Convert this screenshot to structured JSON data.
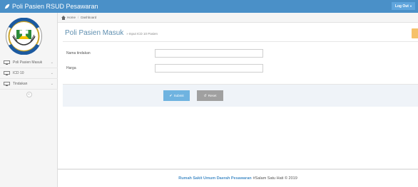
{
  "app": {
    "title": "Poli Pasien RSUD Pesawaran",
    "logout_label": "Log Out",
    "accent_color": "#4a90c8"
  },
  "sidebar": {
    "items": [
      {
        "label": "Poli Pasien Masuk",
        "icon": "monitor-icon"
      },
      {
        "label": "ICD 10",
        "icon": "monitor-icon"
      },
      {
        "label": "Tindakan",
        "icon": "monitor-icon"
      }
    ],
    "collapse_glyph": "«"
  },
  "breadcrumb": {
    "home": "Home",
    "current": "Dashboard"
  },
  "page": {
    "title": "Poli Pasien Masuk",
    "subtitle": "Input ICD 10 Pasien"
  },
  "form": {
    "fields": [
      {
        "label": "Nama tindakan",
        "value": "",
        "placeholder": ""
      },
      {
        "label": "Harga",
        "value": "",
        "placeholder": ""
      }
    ],
    "submit_label": "Submit",
    "reset_label": "Reset"
  },
  "footer": {
    "org": "Rumah Sakit Umum Daerah Pesawaran",
    "tagline": "#Salam Satu Hati © 2019"
  }
}
